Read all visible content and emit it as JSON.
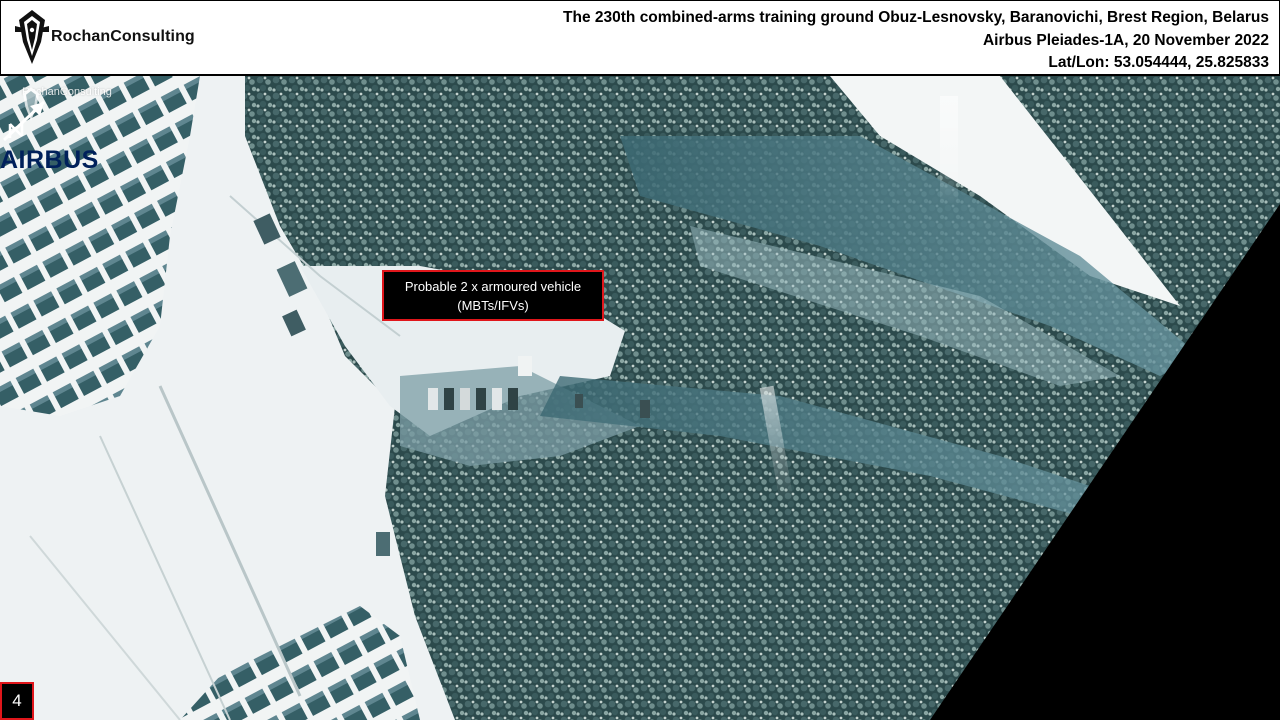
{
  "header": {
    "brand_name": "RochanConsulting",
    "title": "The 230th combined-arms training ground Obuz-Lesnovsky, Baranovichi, Brest Region, Belarus",
    "source_line": "Airbus Pleiades-1A, 20 November 2022",
    "coords_line": "Lat/Lon:  53.054444, 25.825833"
  },
  "watermarks": {
    "rochan_text": "RochanConsulting",
    "airbus_text": "AIRBUS"
  },
  "annotation": {
    "line1": "Probable 2 x armoured vehicle",
    "line2": "(MBTs/IFVs)"
  },
  "slide_number": "4",
  "colors": {
    "annotation_border": "#e0161b",
    "annotation_bg": "#000000",
    "snow": "#eef2f3",
    "forest": "#2c4a4c",
    "shadow": "#4d7580",
    "airbus_blue": "#00205b"
  },
  "icons": {
    "brand": "pen-nib-logo-icon",
    "north": "north-arrow-icon"
  }
}
